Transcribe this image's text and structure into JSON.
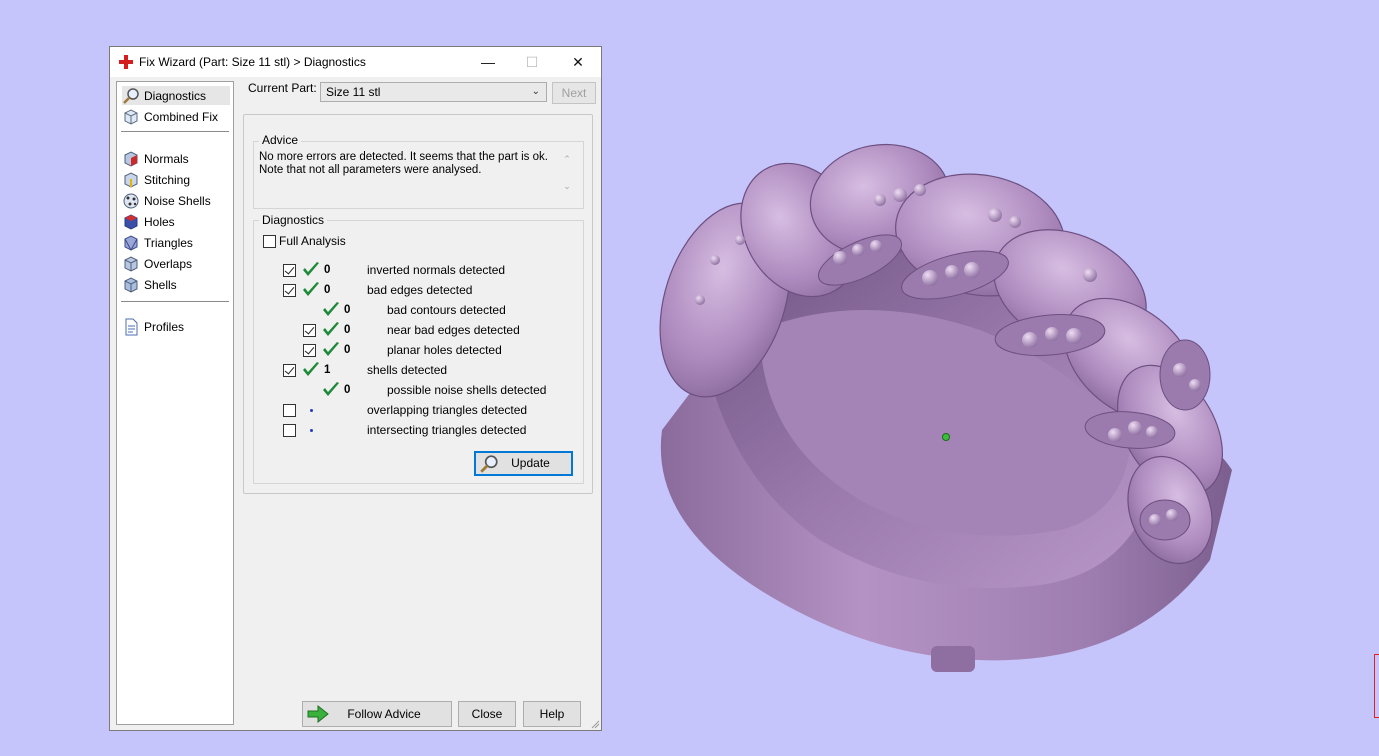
{
  "window": {
    "title": "Fix Wizard (Part: Size 11 stl) > Diagnostics",
    "minimize_glyph": "—",
    "maximize_glyph": "☐",
    "close_glyph": "✕"
  },
  "nav": {
    "items": [
      {
        "label": "Diagnostics",
        "icon": "magnifier-icon",
        "selected": true
      },
      {
        "label": "Combined Fix",
        "icon": "cube-icon"
      },
      {
        "label": "Normals",
        "icon": "normals-cube-icon"
      },
      {
        "label": "Stitching",
        "icon": "stitching-cube-icon"
      },
      {
        "label": "Noise Shells",
        "icon": "noise-shells-icon"
      },
      {
        "label": "Holes",
        "icon": "holes-cube-icon"
      },
      {
        "label": "Triangles",
        "icon": "triangles-cube-icon"
      },
      {
        "label": "Overlaps",
        "icon": "overlaps-cube-icon"
      },
      {
        "label": "Shells",
        "icon": "shells-cube-icon"
      },
      {
        "label": "Profiles",
        "icon": "document-icon"
      }
    ]
  },
  "part": {
    "label": "Current Part:",
    "value": "Size 11 stl",
    "next_label": "Next"
  },
  "advice": {
    "title": "Advice",
    "line1": "No more errors are detected. It seems that the part is ok.",
    "line2": "Note that not all parameters were analysed."
  },
  "diagnostics": {
    "title": "Diagnostics",
    "full_analysis_label": "Full Analysis",
    "full_analysis_checked": false,
    "rows": [
      {
        "checked": true,
        "status": "ok",
        "count": "0",
        "label": "inverted normals detected",
        "indent": 0,
        "has_checkbox": true
      },
      {
        "checked": true,
        "status": "ok",
        "count": "0",
        "label": "bad edges detected",
        "indent": 0,
        "has_checkbox": true
      },
      {
        "checked": false,
        "status": "ok",
        "count": "0",
        "label": "bad contours detected",
        "indent": 1,
        "has_checkbox": false
      },
      {
        "checked": true,
        "status": "ok",
        "count": "0",
        "label": "near bad edges detected",
        "indent": 1,
        "has_checkbox": true
      },
      {
        "checked": true,
        "status": "ok",
        "count": "0",
        "label": "planar holes detected",
        "indent": 1,
        "has_checkbox": true
      },
      {
        "checked": true,
        "status": "ok",
        "count": "1",
        "label": "shells detected",
        "indent": 0,
        "has_checkbox": true
      },
      {
        "checked": false,
        "status": "ok",
        "count": "0",
        "label": "possible noise shells detected",
        "indent": 1,
        "has_checkbox": false
      },
      {
        "checked": false,
        "status": "pending",
        "count": "",
        "label": "overlapping triangles detected",
        "indent": 0,
        "has_checkbox": true
      },
      {
        "checked": false,
        "status": "pending",
        "count": "",
        "label": "intersecting triangles detected",
        "indent": 0,
        "has_checkbox": true
      }
    ],
    "update_label": "Update"
  },
  "footer": {
    "follow_advice_label": "Follow Advice",
    "close_label": "Close",
    "help_label": "Help"
  },
  "colors": {
    "viewport_bg": "#c5c5fb",
    "model": "#b98fc4",
    "check_green": "#1f8a3a",
    "pending_dot": "#1e3fbf"
  }
}
